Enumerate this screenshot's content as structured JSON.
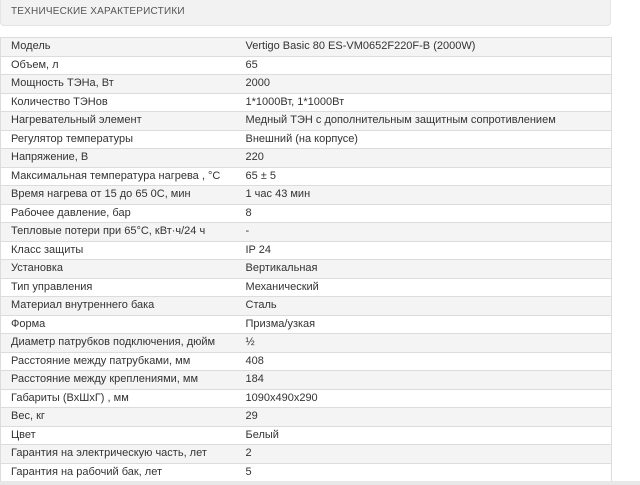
{
  "header": {
    "title": "ТЕХНИЧЕСКИЕ ХАРАКТЕРИСТИКИ"
  },
  "specs": [
    {
      "name": "Модель",
      "value": "Vertigo Basic 80 ES-VM0652F220F-B (2000W)"
    },
    {
      "name": "Объем, л",
      "value": "65"
    },
    {
      "name": "Мощность ТЭНа, Вт",
      "value": "2000"
    },
    {
      "name": "Количество ТЭНов",
      "value": "1*1000Вт, 1*1000Вт"
    },
    {
      "name": "Нагревательный элемент",
      "value": "Медный ТЭН с дополнительным защитным сопротивлением"
    },
    {
      "name": "Регулятор температуры",
      "value": "Внешний (на корпусе)"
    },
    {
      "name": "Напряжение, В",
      "value": "220"
    },
    {
      "name": "Максимальная температура нагрева , °C",
      "value": "65 ± 5"
    },
    {
      "name": "Время нагрева от 15 до 65 0С, мин",
      "value": "1 час 43 мин"
    },
    {
      "name": "Рабочее давление, бар",
      "value": "8"
    },
    {
      "name": "Тепловые потери при 65°C, кВт·ч/24 ч",
      "value": "-"
    },
    {
      "name": "Класс защиты",
      "value": "IP 24"
    },
    {
      "name": "Установка",
      "value": "Вертикальная"
    },
    {
      "name": "Тип управления",
      "value": "Механический"
    },
    {
      "name": "Материал внутреннего бака",
      "value": "Сталь"
    },
    {
      "name": "Форма",
      "value": "Призма/узкая"
    },
    {
      "name": "Диаметр патрубков подключения, дюйм",
      "value": "½"
    },
    {
      "name": "Расстояние между патрубками, мм",
      "value": "408"
    },
    {
      "name": "Расстояние между креплениями, мм",
      "value": "184"
    },
    {
      "name": "Габариты (ВхШхГ) , мм",
      "value": "1090х490х290"
    },
    {
      "name": "Вес, кг",
      "value": "29"
    },
    {
      "name": "Цвет",
      "value": "Белый"
    },
    {
      "name": "Гарантия на электрическую часть, лет",
      "value": "2"
    },
    {
      "name": "Гарантия на рабочий бак, лет",
      "value": "5"
    }
  ]
}
